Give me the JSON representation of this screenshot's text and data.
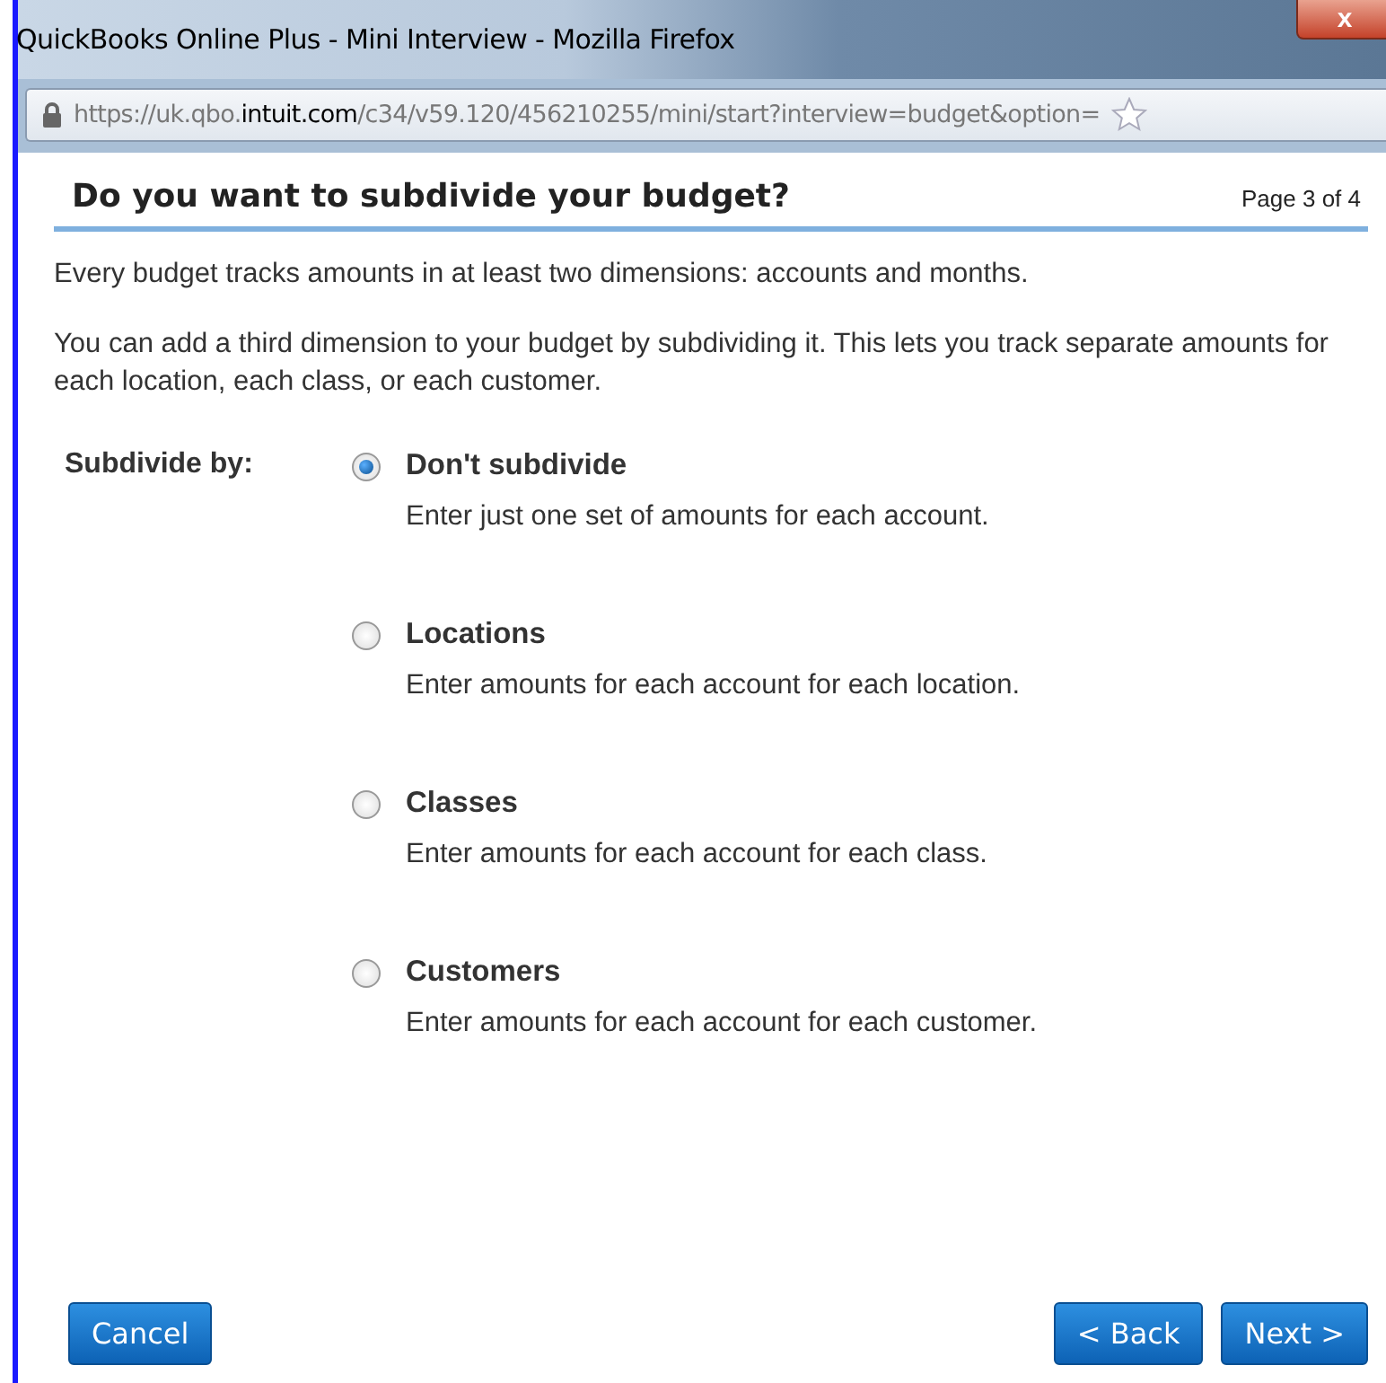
{
  "window": {
    "title": "QuickBooks Online Plus - Mini Interview - Mozilla Firefox",
    "close": "x"
  },
  "address_bar": {
    "url_start": "https://uk.qbo.",
    "url_domain": "intuit.com",
    "url_rest": "/c34/v59.120/456210255/mini/start?interview=budget&option="
  },
  "heading": "Do you want to subdivide your budget?",
  "page_indicator": "Page 3 of 4",
  "intro": [
    "Every budget tracks amounts in at least two dimensions: accounts and months.",
    "You can add a third dimension to your budget by subdividing it. This lets you track separate amounts for each location, each class, or each customer."
  ],
  "subdivide_label": "Subdivide by:",
  "options": [
    {
      "label": "Don't subdivide",
      "description": "Enter just one set of amounts for each account.",
      "selected": true
    },
    {
      "label": "Locations",
      "description": "Enter amounts for each account for each location.",
      "selected": false
    },
    {
      "label": "Classes",
      "description": "Enter amounts for each account for each class.",
      "selected": false
    },
    {
      "label": "Customers",
      "description": "Enter amounts for each account for each customer.",
      "selected": false
    }
  ],
  "buttons": {
    "cancel": "Cancel",
    "back": "< Back",
    "next": "Next >"
  }
}
